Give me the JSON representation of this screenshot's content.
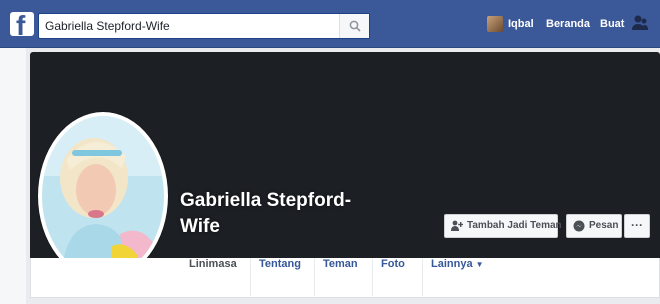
{
  "topbar": {
    "logo_letter": "f",
    "search_value": "Gabriella Stepford-Wife",
    "user_name": "Iqbal",
    "home_label": "Beranda",
    "find_label": "Buat",
    "icons": [
      "facebook-logo",
      "search-icon",
      "avatar",
      "friend-requests-icon"
    ]
  },
  "profile": {
    "name": "Gabriella Stepford-Wife",
    "add_friend_label": "Tambah Jadi Teman",
    "message_label": "Pesan",
    "more_label": "···"
  },
  "tabs": [
    {
      "label": "Linimasa"
    },
    {
      "label": "Tentang"
    },
    {
      "label": "Teman"
    },
    {
      "label": "Foto"
    },
    {
      "label": "Lainnya",
      "caret": "▼"
    }
  ],
  "colors": {
    "brand": "#3b5998",
    "cover": "#1c1f24",
    "link": "#365899"
  }
}
